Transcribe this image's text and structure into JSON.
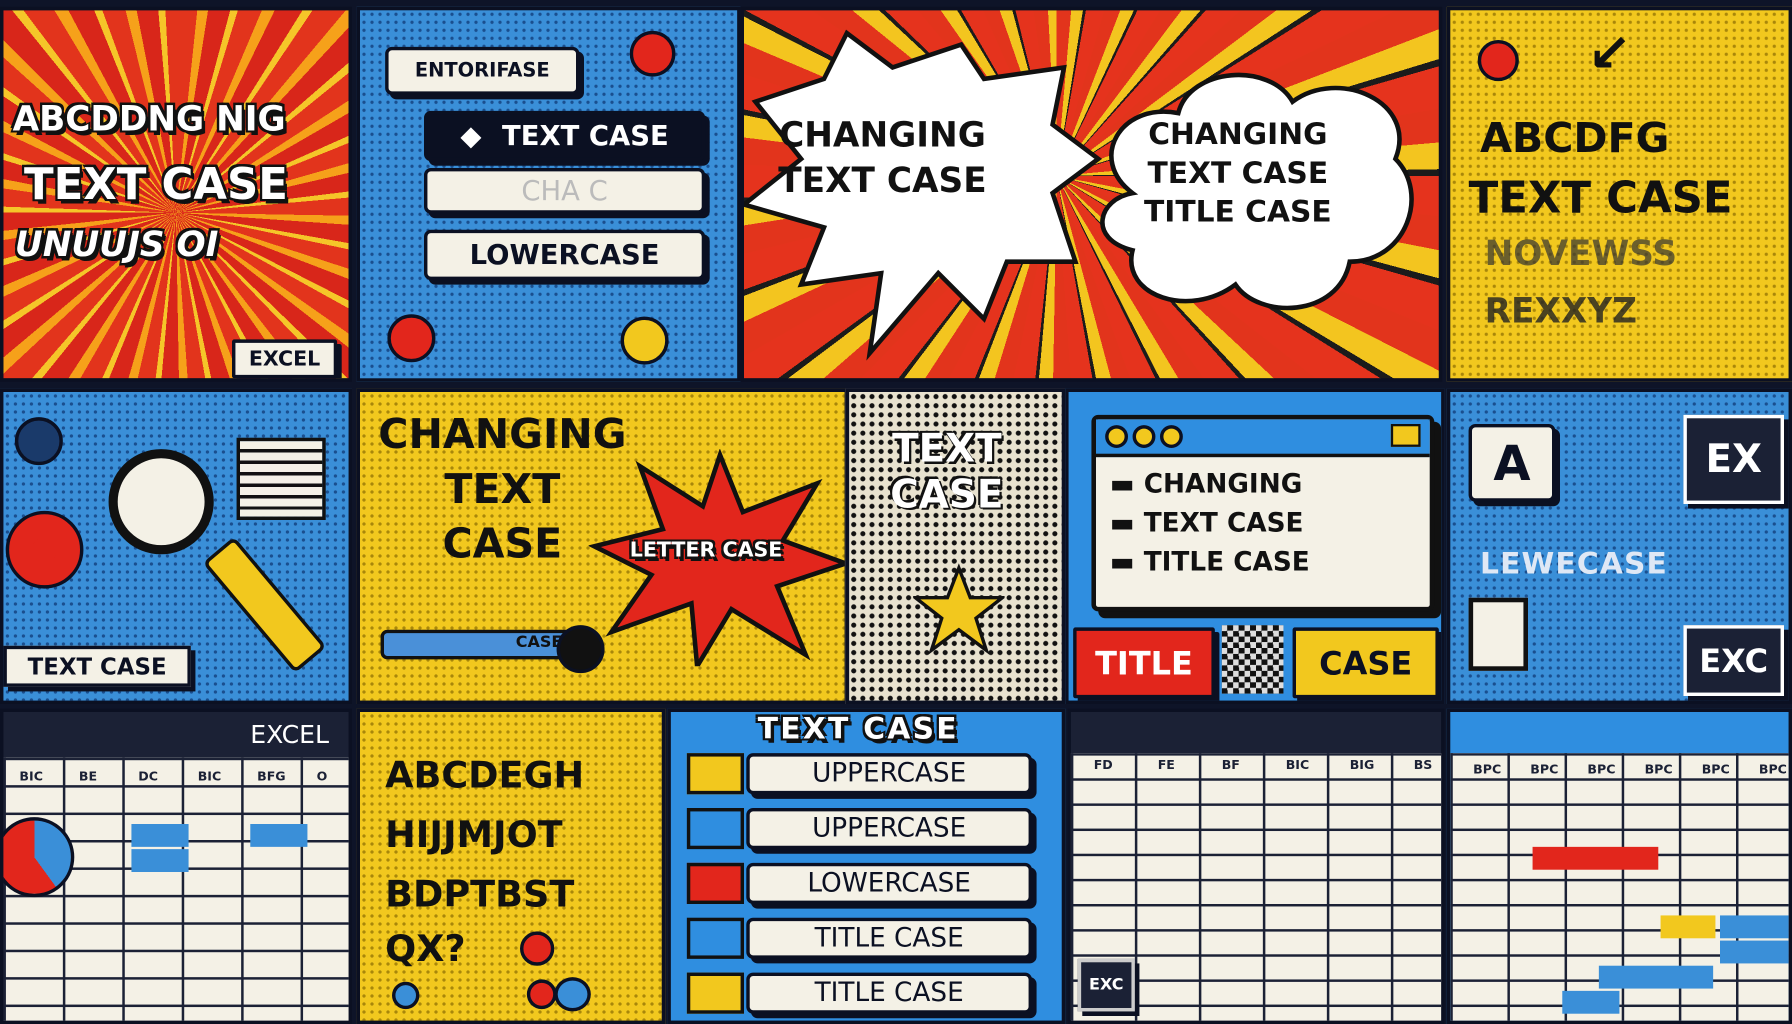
{
  "panel_1": {
    "lines": [
      "ABCDDNG NIG",
      "TEXT CASE",
      "UNUUJS OI"
    ],
    "badge": "EXCEL"
  },
  "panel_2": {
    "field_label": "ENTORIFASE",
    "rows": [
      "TEXT CASE",
      "CHA C",
      "LOWERCASE"
    ]
  },
  "panel_3": {
    "burst_text": "CHANGING\nTEXT CASE",
    "cloud_text": "CHANGING\nTEXT CASE\nTITLE CASE"
  },
  "panel_4": {
    "lines": [
      "ABCDFG",
      "TEXT CASE",
      "NOVEWSS",
      "REXXYZ"
    ]
  },
  "panel_5": {
    "label": "TEXT CASE"
  },
  "panel_6": {
    "title": "CHANGING\nTEXT\nCASE",
    "star_text": "LETTER CASE",
    "bar_text": "CASE"
  },
  "panel_7": {
    "title": "TEXT\nCASE"
  },
  "panel_8": {
    "list": [
      "CHANGING",
      "TEXT CASE",
      "TITLE CASE"
    ],
    "buttons": [
      "TITLE",
      "CASE"
    ]
  },
  "panel_9": {
    "tile": "A",
    "label": "LEWECASE",
    "box_top": "EX",
    "box_bottom": "EXC"
  },
  "panel_10": {
    "header": "EXCEL",
    "columns": [
      "BIC",
      "BE",
      "DC",
      "BIC",
      "BFG",
      "O"
    ]
  },
  "panel_11": {
    "lines": [
      "ABCDEGH",
      "HIJJMJOT",
      "BDPTBST",
      "QX?"
    ]
  },
  "panel_12": {
    "title": "TEXT CASE",
    "items": [
      {
        "label": "UPPERCASE",
        "color": "#f2c81e"
      },
      {
        "label": "UPPERCASE",
        "color": "#2f8ee0"
      },
      {
        "label": "LOWERCASE",
        "color": "#e2261c"
      },
      {
        "label": "TITLE CASE",
        "color": "#2f8ee0"
      },
      {
        "label": "TITLE CASE",
        "color": "#f2c81e"
      }
    ]
  },
  "panel_13": {
    "columns": [
      "FD",
      "FE",
      "BF",
      "BIC",
      "BIG",
      "BS"
    ],
    "badge": "EXC"
  },
  "panel_14": {
    "columns": [
      "BPC",
      "BPC",
      "BPC",
      "BPC",
      "BPC",
      "BPC"
    ]
  },
  "colors": {
    "red": "#e2261c",
    "yellow": "#f2c81e",
    "blue": "#3a8fd8",
    "navy": "#0b1022",
    "cream": "#f4f1e6"
  }
}
